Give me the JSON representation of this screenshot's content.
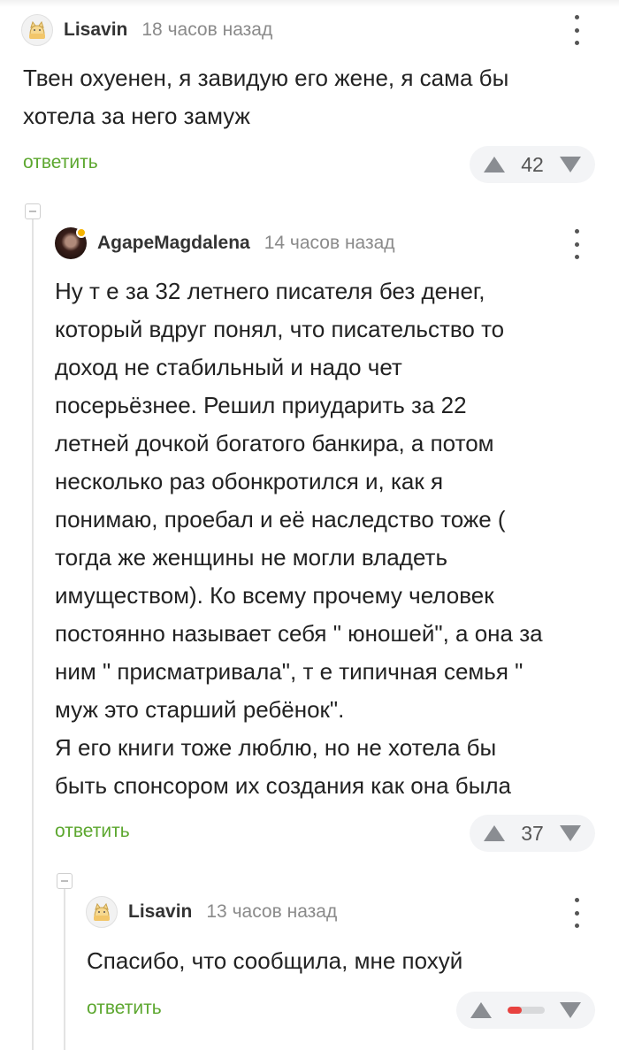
{
  "comments": [
    {
      "username": "Lisavin",
      "time": "18 часов назад",
      "text": "Твен охуенен, я завидую его жене, я сама бы\nхотела за него замуж",
      "reply_label": "ответить",
      "rating": "42"
    },
    {
      "username": "AgapeMagdalena",
      "time": "14 часов назад",
      "text": "Ну т е за 32 летнего писателя без денег,\nкоторый вдруг понял, что писательство то\nдоход не стабильный и надо чет\nпосерьёзнее. Решил приударить за 22\nлетней дочкой богатого банкира, а потом\nнесколько раз обонкротился и, как я\nпонимаю, проебал и её наследство тоже (\nтогда же женщины не могли владеть\nимуществом). Ко всему прочему человек\nпостоянно называет себя \" юношей\", а она за\nним \" присматривала\", т е типичная семья \"\nмуж это старший ребёнок\".\nЯ его книги тоже люблю, но не хотела бы\nбыть спонсором их создания как она была",
      "reply_label": "ответить",
      "rating": "37"
    },
    {
      "username": "Lisavin",
      "time": "13 часов назад",
      "text": "Спасибо, что сообщила, мне похуй",
      "reply_label": "ответить",
      "rating_fraction": 0.4
    }
  ],
  "icons": {
    "avatar_cat": "cat-avatar-icon",
    "avatar_woman": "woman-avatar-icon",
    "more": "more-vertical-icon",
    "upvote": "arrow-up-icon",
    "downvote": "arrow-down-icon",
    "collapse": "collapse-minus-icon"
  },
  "colors": {
    "reply": "#5ca72f",
    "negative": "#e8423f",
    "online": "#f5b400"
  }
}
